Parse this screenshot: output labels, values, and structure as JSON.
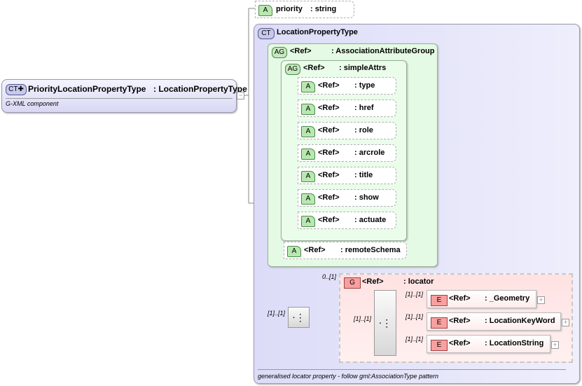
{
  "root": {
    "badge": "CT",
    "name": "PriorityLocationPropertyType",
    "base": ": LocationPropertyType",
    "doc": "G-XML component"
  },
  "priority": {
    "badge": "A",
    "name": "priority",
    "type": ": string"
  },
  "ct": {
    "badge": "CT",
    "name": "LocationPropertyType",
    "doc": "generalised locator property  - follow gml:AssociationType pattern"
  },
  "assoc": {
    "badge": "AG",
    "ref": "<Ref>",
    "name": ": AssociationAttributeGroup"
  },
  "simple": {
    "badge": "AG",
    "ref": "<Ref>",
    "name": ": simpleAttrs"
  },
  "attrs": [
    {
      "badge": "A",
      "ref": "<Ref>",
      "name": ": type"
    },
    {
      "badge": "A",
      "ref": "<Ref>",
      "name": ": href"
    },
    {
      "badge": "A",
      "ref": "<Ref>",
      "name": ": role"
    },
    {
      "badge": "A",
      "ref": "<Ref>",
      "name": ": arcrole"
    },
    {
      "badge": "A",
      "ref": "<Ref>",
      "name": ": title"
    },
    {
      "badge": "A",
      "ref": "<Ref>",
      "name": ": show"
    },
    {
      "badge": "A",
      "ref": "<Ref>",
      "name": ": actuate"
    }
  ],
  "remote": {
    "badge": "A",
    "ref": "<Ref>",
    "name": ": remoteSchema"
  },
  "seq_card": "[1]..[1]",
  "group": {
    "badge": "G",
    "ref": "<Ref>",
    "name": ": locator",
    "card": "0..[1]",
    "choice_card": "[1]..[1]"
  },
  "elements": [
    {
      "badge": "E",
      "ref": "<Ref>",
      "name": ": _Geometry",
      "card": "[1]..[1]"
    },
    {
      "badge": "E",
      "ref": "<Ref>",
      "name": ": LocationKeyWord",
      "card": "[1]..[1]"
    },
    {
      "badge": "E",
      "ref": "<Ref>",
      "name": ": LocationString",
      "card": "[1]..[1]"
    }
  ],
  "expand": "+",
  "collapse": "−"
}
